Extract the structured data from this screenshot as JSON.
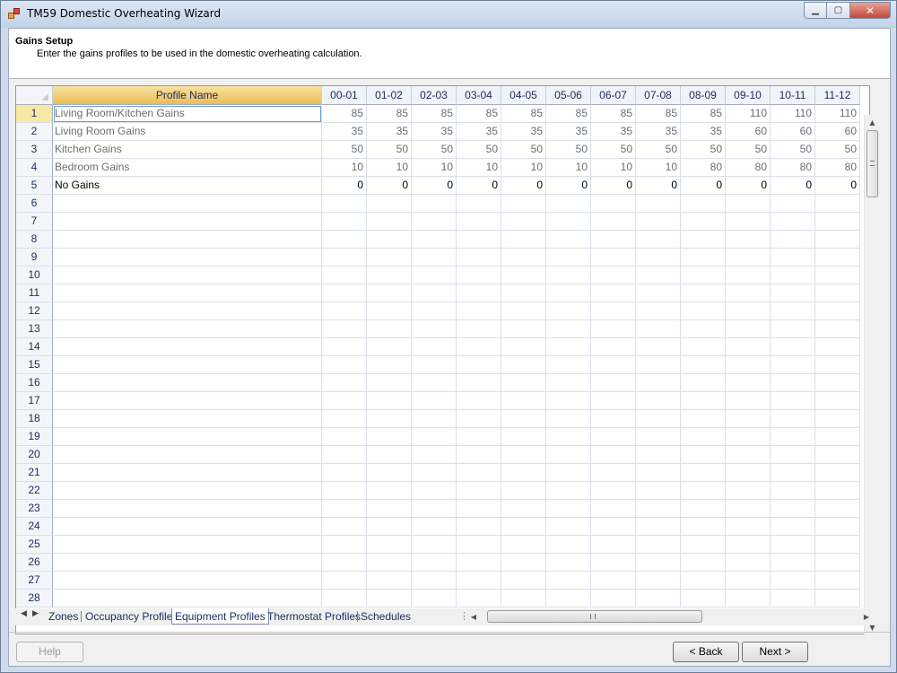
{
  "window": {
    "title": "TM59 Domestic Overheating Wizard",
    "min_glyph": "▁",
    "max_glyph": "▢",
    "close_glyph": "✕"
  },
  "header": {
    "title": "Gains Setup",
    "description": "Enter the gains profiles to be used in the domestic overheating calculation."
  },
  "grid": {
    "name_header": "Profile Name",
    "hour_headers": [
      "00-01",
      "01-02",
      "02-03",
      "03-04",
      "04-05",
      "05-06",
      "06-07",
      "07-08",
      "08-09",
      "09-10",
      "10-11",
      "11-12"
    ],
    "rows": [
      {
        "num": "1",
        "name": "Living Room/Kitchen Gains",
        "values": [
          "85",
          "85",
          "85",
          "85",
          "85",
          "85",
          "85",
          "85",
          "85",
          "110",
          "110",
          "110"
        ]
      },
      {
        "num": "2",
        "name": "Living Room Gains",
        "values": [
          "35",
          "35",
          "35",
          "35",
          "35",
          "35",
          "35",
          "35",
          "35",
          "60",
          "60",
          "60"
        ]
      },
      {
        "num": "3",
        "name": "Kitchen Gains",
        "values": [
          "50",
          "50",
          "50",
          "50",
          "50",
          "50",
          "50",
          "50",
          "50",
          "50",
          "50",
          "50"
        ]
      },
      {
        "num": "4",
        "name": "Bedroom Gains",
        "values": [
          "10",
          "10",
          "10",
          "10",
          "10",
          "10",
          "10",
          "10",
          "80",
          "80",
          "80",
          "80"
        ]
      },
      {
        "num": "5",
        "name": "No Gains",
        "values": [
          "0",
          "0",
          "0",
          "0",
          "0",
          "0",
          "0",
          "0",
          "0",
          "0",
          "0",
          "0"
        ]
      }
    ],
    "empty_row_numbers": [
      "6",
      "7",
      "8",
      "9",
      "10",
      "11",
      "12",
      "13",
      "14",
      "15",
      "16",
      "17",
      "18",
      "19",
      "20",
      "21",
      "22",
      "23",
      "24",
      "25",
      "26",
      "27",
      "28"
    ]
  },
  "tabs": {
    "items": [
      "Zones",
      "Occupancy Profiles",
      "Equipment Profiles",
      "Thermostat Profiles",
      "Schedules"
    ],
    "active": "Equipment Profiles",
    "prev_glyph": "◀",
    "next_glyph": "▶",
    "splitter_glyph": "⋮"
  },
  "scroll": {
    "up": "▲",
    "down": "▼",
    "left": "◀",
    "right": "▶"
  },
  "buttons": {
    "help": "Help",
    "back": "< Back",
    "next": "Next >"
  }
}
